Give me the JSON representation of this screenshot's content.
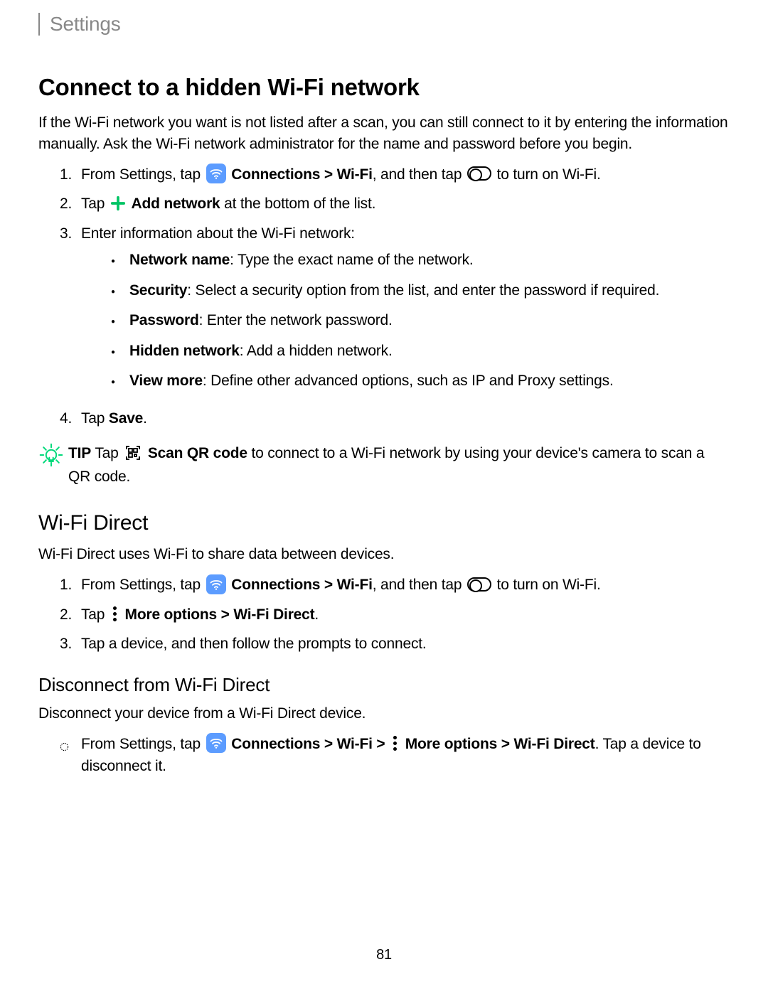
{
  "header": {
    "title": "Settings"
  },
  "s1": {
    "heading": "Connect to a hidden Wi-Fi network",
    "intro": "If the Wi-Fi network you want is not listed after a scan, you can still connect to it by entering the information manually. Ask the Wi-Fi network administrator for the name and password before you begin.",
    "step1_a": "From Settings, tap",
    "step1_b": "Connections",
    "step1_c": " > ",
    "step1_d": "Wi-Fi",
    "step1_e": ", and then tap",
    "step1_f": "to turn on Wi-Fi.",
    "step2_a": "Tap",
    "step2_b": "Add network",
    "step2_c": " at the bottom of the list.",
    "step3": "Enter information about the Wi-Fi network:",
    "b1_label": "Network name",
    "b1_text": ": Type the exact name of the network.",
    "b2_label": "Security",
    "b2_text": ": Select a security option from the list, and enter the password if required.",
    "b3_label": "Password",
    "b3_text": ": Enter the network password.",
    "b4_label": "Hidden network",
    "b4_text": ": Add a hidden network.",
    "b5_label": "View more",
    "b5_text": ": Define other advanced options, such as IP and Proxy settings.",
    "step4_a": "Tap ",
    "step4_b": "Save",
    "step4_c": ".",
    "tip_label": "TIP",
    "tip_a": "  Tap",
    "tip_b": "Scan QR code",
    "tip_c": " to connect to a Wi-Fi network by using your device's camera to scan a QR code."
  },
  "s2": {
    "heading": "Wi-Fi Direct",
    "intro": "Wi-Fi Direct uses Wi-Fi to share data between devices.",
    "step1_a": "From Settings, tap",
    "step1_b": "Connections",
    "step1_c": " > ",
    "step1_d": "Wi-Fi",
    "step1_e": ", and then tap",
    "step1_f": "to turn on Wi-Fi.",
    "step2_a": "Tap",
    "step2_b": "More options",
    "step2_c": " > ",
    "step2_d": "Wi-Fi Direct",
    "step2_e": ".",
    "step3": "Tap a device, and then follow the prompts to connect."
  },
  "s3": {
    "heading": "Disconnect from Wi-Fi Direct",
    "intro": "Disconnect your device from a Wi-Fi Direct device.",
    "step_a": "From Settings, tap",
    "step_b": "Connections",
    "step_c": " > ",
    "step_d": "Wi-Fi",
    "step_e": " > ",
    "step_f": "More options",
    "step_g": " > ",
    "step_h": "Wi-Fi Direct",
    "step_i": ". Tap a device to disconnect it."
  },
  "page": "81"
}
